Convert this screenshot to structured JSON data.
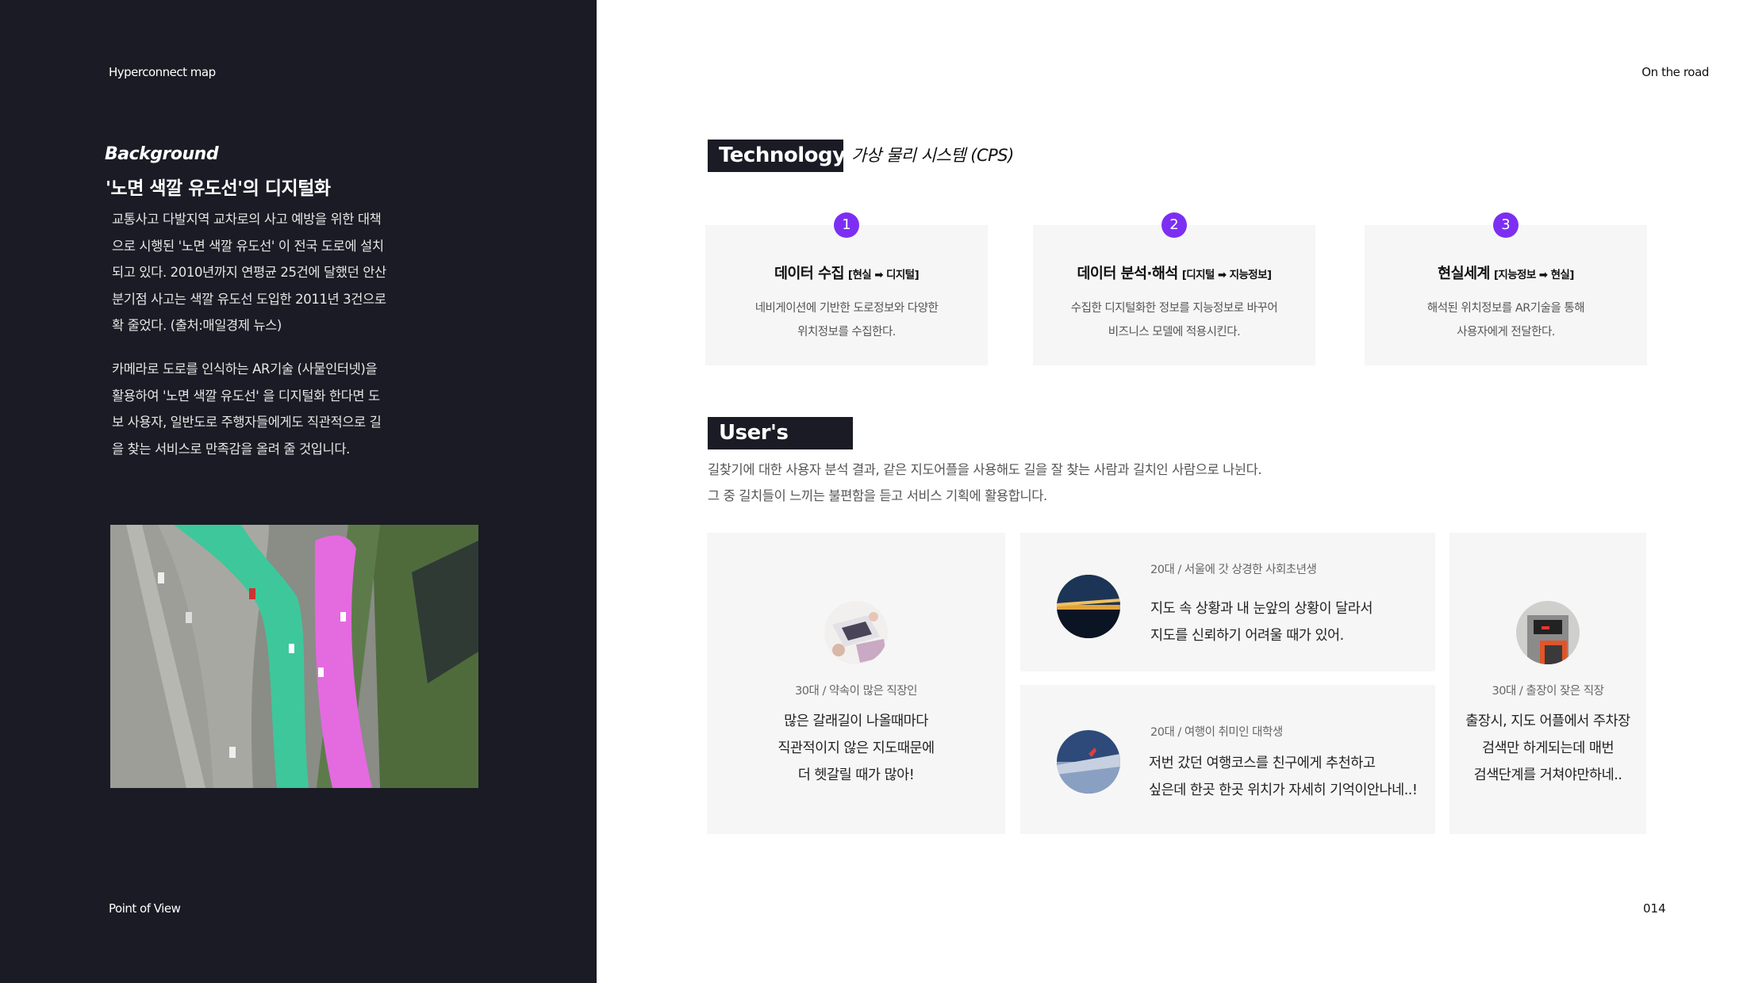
{
  "left": {
    "brand": "Hyperconnect map",
    "background_title": "Background",
    "background_subtitle": "'노면 색깔 유도선'의 디지털화",
    "paragraph1": "교통사고 다발지역 교차로의 사고 예방을 위한 대책으로 시행된 '노면 색깔 유도선' 이  전국 도로에 설치되고 있다. 2010년까지 연평균 25건에 달했던 안산분기점 사고는 색깔 유도선 도입한 2011년 3건으로 확 줄었다. (출처:매일경제 뉴스)",
    "paragraph2": "카메라로 도로를 인식하는 AR기술 (사물인터넷)을 활용하여 '노면 색깔 유도선' 을 디지털화 한다면 도보 사용자, 일반도로 주행자들에게도 직관적으로 길을 찾는 서비스로 만족감을 올려 줄 것입니다.",
    "footer": "Point of View",
    "road_colors": {
      "green": "#3ec79b",
      "pink": "#e46ae0"
    }
  },
  "header": {
    "right_label": "On the road"
  },
  "page_number": "014",
  "technology": {
    "tag": "Technology",
    "subtitle": "가상 물리 시스템 (CPS)",
    "accent": "#7c2ff2",
    "cards": [
      {
        "num": "1",
        "title": "데이터 수집",
        "sub": "[현실 ➡ 디지털]",
        "desc1": "네비게이션에 기반한 도로정보와 다양한",
        "desc2": "위치정보를 수집한다."
      },
      {
        "num": "2",
        "title": "데이터 분석·해석",
        "sub": "[디지털 ➡ 지능정보]",
        "desc1": "수집한 디지털화한 정보를 지능정보로 바꾸어",
        "desc2": "비즈니스 모델에 적용시킨다."
      },
      {
        "num": "3",
        "title": "현실세계",
        "sub": "[지능정보 ➡ 현실]",
        "desc1": "해석된 위치정보를 AR기술을 통해",
        "desc2": "사용자에게 전달한다."
      }
    ]
  },
  "voice": {
    "tag": "User's Voice",
    "desc1": "길찾기에 대한 사용자 분석 결과, 같은 지도어플을 사용해도 길을 잘 찾는 사람과 길치인 사람으로 나뉜다.",
    "desc2": "그 중 길치들이 느끼는 불편함을 듣고 서비스 기획에 활용합니다.",
    "cards": [
      {
        "meta": "30대 / 약속이 많은 직장인",
        "q1": "많은 갈래길이 나올때마다",
        "q2": "직관적이지 않은 지도때문에",
        "q3": "더 헷갈릴 때가 많아!"
      },
      {
        "meta": "20대 / 서울에 갓 상경한 사회초년생",
        "q1": "지도 속 상황과 내 눈앞의 상황이 달라서",
        "q2": "지도를 신뢰하기 어려울 때가 있어."
      },
      {
        "meta": "20대 / 여행이 취미인 대학생",
        "q1": "저번 갔던 여행코스를 친구에게 추천하고",
        "q2": "싶은데 한곳 한곳 위치가 자세히 기억이안나네..!"
      },
      {
        "meta": "30대 / 출장이 잦은 직장",
        "q1": "출장시, 지도 어플에서 주차장",
        "q2": "검색만 하게되는데 매번",
        "q3": "검색단계를 거쳐야만하네.."
      }
    ]
  }
}
